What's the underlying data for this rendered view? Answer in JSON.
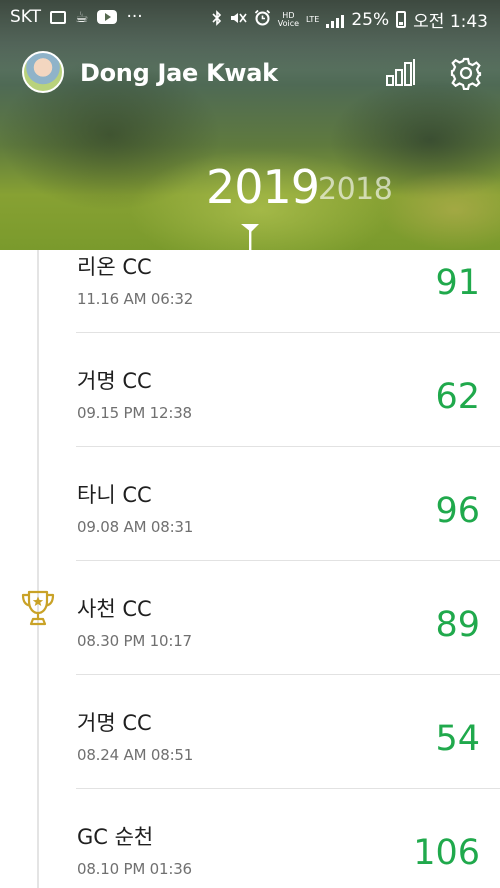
{
  "status_bar": {
    "carrier": "SKT",
    "dots": "···",
    "hd_badge_top": "HD",
    "hd_badge_bottom": "Voice",
    "lte_badge": "LTE",
    "battery": "25%",
    "time": "오전 1:43"
  },
  "header": {
    "user_name": "Dong Jae Kwak",
    "icons": [
      "bar-chart-icon",
      "gear-icon"
    ]
  },
  "year_selector": {
    "selected": "2019",
    "other": "2018"
  },
  "rounds": [
    {
      "course": "리온 CC",
      "datetime": "11.16 AM 06:32",
      "score": "91",
      "trophy": false
    },
    {
      "course": "거명 CC",
      "datetime": "09.15 PM 12:38",
      "score": "62",
      "trophy": false
    },
    {
      "course": "타니 CC",
      "datetime": "09.08 AM 08:31",
      "score": "96",
      "trophy": false
    },
    {
      "course": "사천 CC",
      "datetime": "08.30 PM 10:17",
      "score": "89",
      "trophy": true
    },
    {
      "course": "거명 CC",
      "datetime": "08.24 AM 08:51",
      "score": "54",
      "trophy": false
    },
    {
      "course": "GC 순천",
      "datetime": "08.10 PM 01:36",
      "score": "106",
      "trophy": false
    }
  ],
  "colors": {
    "score_green": "#20a94c",
    "trophy_gold": "#c9a227"
  }
}
